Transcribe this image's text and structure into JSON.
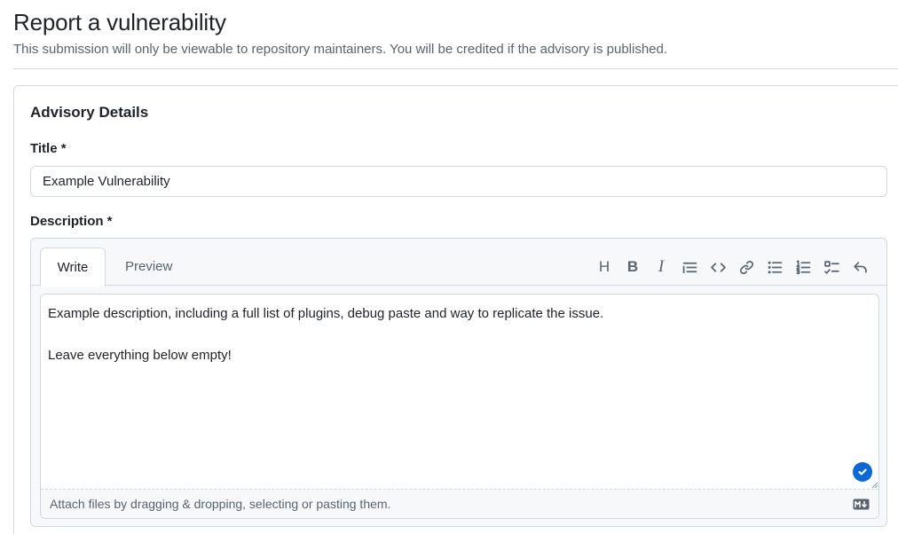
{
  "page": {
    "title": "Report a vulnerability",
    "subtitle": "This submission will only be viewable to repository maintainers. You will be credited if the advisory is published."
  },
  "advisory": {
    "heading": "Advisory Details",
    "title_label": "Title *",
    "title_value": "Example Vulnerability",
    "description_label": "Description *"
  },
  "editor": {
    "tabs": [
      {
        "label": "Write",
        "selected": true
      },
      {
        "label": "Preview",
        "selected": false
      }
    ],
    "toolbar": [
      {
        "icon": "heading-icon",
        "glyph": "H"
      },
      {
        "icon": "bold-icon",
        "glyph": "B"
      },
      {
        "icon": "italic-icon",
        "glyph": "I"
      },
      {
        "icon": "quote-icon"
      },
      {
        "icon": "code-icon"
      },
      {
        "icon": "link-icon"
      },
      {
        "icon": "unordered-list-icon"
      },
      {
        "icon": "ordered-list-icon"
      },
      {
        "icon": "task-list-icon"
      },
      {
        "icon": "reply-icon"
      }
    ],
    "description_value": "Example description, including a full list of plugins, debug paste and way to replicate the issue.\n\nLeave everything below empty!",
    "attach_text": "Attach files by dragging & dropping, selecting or pasting them.",
    "markdown_icon": "markdown-icon"
  },
  "colors": {
    "accent": "#0969da",
    "border": "#d1d9e0",
    "muted_text": "#59636e"
  }
}
